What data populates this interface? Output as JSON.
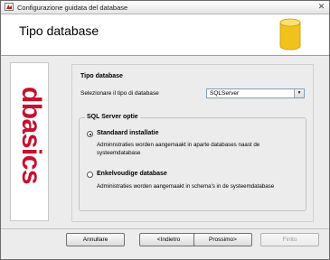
{
  "window": {
    "title": "Configurazione guidata del database",
    "close_glyph": "✕"
  },
  "header": {
    "title": "Tipo database"
  },
  "sidebar": {
    "logo_text": "dbasics"
  },
  "content": {
    "section_title": "Tipo database",
    "select_label": "Selezionare il tipo di database",
    "select_value": "SQLServer",
    "select_arrow": "▼",
    "group_title": "SQL Server optie",
    "options": [
      {
        "label": "Standaard installatie",
        "description": "Adminnstraties worden aangemaakt in aparte databases naast de systeemdatabase",
        "selected": true
      },
      {
        "label": "Enkelvoudige database",
        "description": "Administraties worden aangemaakt in schema's in de systeemdatabase",
        "selected": false
      }
    ]
  },
  "buttons": {
    "cancel": "Annullare",
    "back": "<Indietro",
    "next": "Prossimo>",
    "finish": "Finito"
  },
  "colors": {
    "logo": "#c8102e",
    "db_icon": "#f2c21c"
  }
}
